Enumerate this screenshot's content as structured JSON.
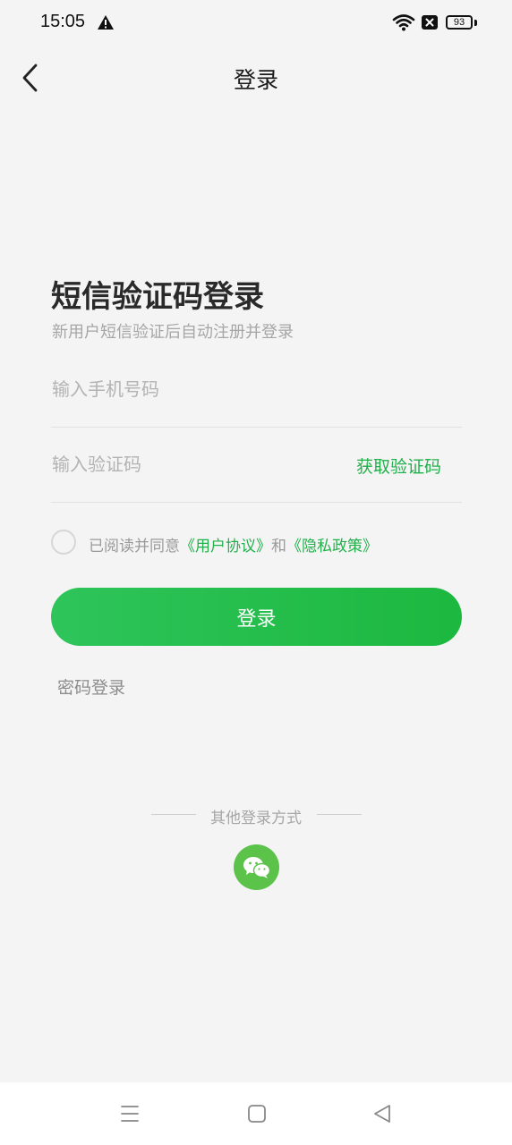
{
  "status_bar": {
    "time": "15:05",
    "battery_level": "93",
    "icons": [
      "warning-icon",
      "wifi-icon",
      "sim-off-icon",
      "battery-icon"
    ]
  },
  "header": {
    "title": "登录",
    "back_icon": "chevron-left-icon"
  },
  "form": {
    "title": "短信验证码登录",
    "subtitle": "新用户短信验证后自动注册并登录",
    "phone_placeholder": "输入手机号码",
    "phone_value": "",
    "code_placeholder": "输入验证码",
    "code_value": "",
    "get_code_label": "获取验证码",
    "agreement": {
      "checked": false,
      "prefix": "已阅读并同意",
      "user_agreement": "《用户协议》",
      "and": "和",
      "privacy_policy": "《隐私政策》"
    },
    "login_button": "登录",
    "password_login": "密码登录"
  },
  "other_login": {
    "label": "其他登录方式",
    "methods": [
      {
        "icon": "wechat-icon"
      }
    ]
  },
  "nav_bar": {
    "icons": [
      "menu-icon",
      "home-icon",
      "back-triangle-icon"
    ]
  },
  "colors": {
    "accent": "#22b04b",
    "background": "#f4f4f4",
    "wechat": "#5bc24a"
  }
}
